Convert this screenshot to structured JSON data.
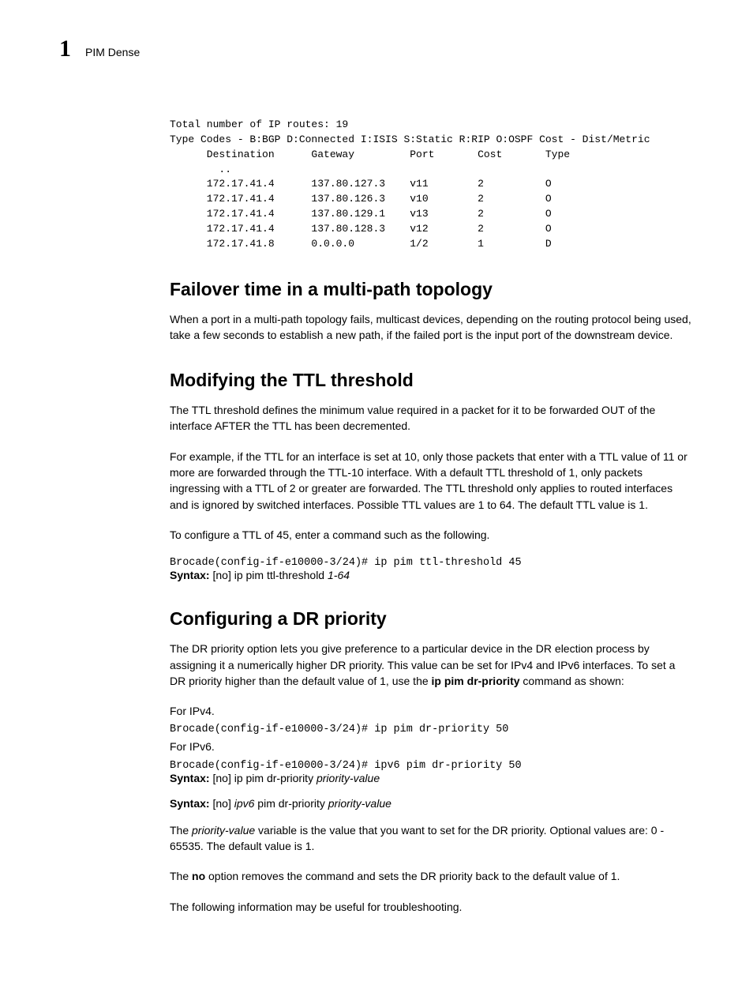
{
  "header": {
    "chapter": "1",
    "title": "PIM Dense"
  },
  "routes": {
    "line1": "Total number of IP routes: 19",
    "line2": "Type Codes - B:BGP D:Connected I:ISIS S:Static R:RIP O:OSPF Cost - Dist/Metric",
    "cols": "      Destination      Gateway         Port       Cost       Type",
    "dots": "        ..",
    "r1": "      172.17.41.4      137.80.127.3    v11        2          O",
    "r2": "      172.17.41.4      137.80.126.3    v10        2          O",
    "r3": "      172.17.41.4      137.80.129.1    v13        2          O",
    "r4": "      172.17.41.4      137.80.128.3    v12        2          O",
    "r5": "      172.17.41.8      0.0.0.0         1/2        1          D"
  },
  "sec1": {
    "title": "Failover time in a multi-path topology",
    "p1": "When a port in a multi-path topology fails, multicast devices, depending on the routing protocol being used, take a few seconds to establish a new path, if the failed port is the input port of the downstream device."
  },
  "sec2": {
    "title": "Modifying the TTL threshold",
    "p1": "The TTL threshold defines the minimum value required in a packet for it to be forwarded OUT of the interface AFTER the TTL has been decremented.",
    "p2": "For example, if the TTL for an interface is set at 10, only those packets that enter with a TTL value of 11 or more are forwarded through the TTL-10 interface. With a default TTL threshold of 1, only packets ingressing with a TTL of 2 or greater are forwarded. The TTL threshold only applies to routed interfaces and is ignored by switched interfaces. Possible TTL values are 1 to 64. The default TTL value is 1.",
    "p3": "To configure a TTL of 45, enter a command such as the following.",
    "cmd1": "Brocade(config-if-e10000-3/24)# ip pim ttl-threshold 45",
    "syntax_label": "Syntax:",
    "syntax_no": "no",
    "syntax_mid": "ip pim ttl-threshold",
    "syntax_arg": "1-64"
  },
  "sec3": {
    "title": "Configuring a DR priority",
    "p1a": "The DR priority option lets you give preference to a particular device in the DR election process by assigning it a numerically higher DR priority. This value can be set for IPv4 and IPv6 interfaces. To set a DR priority higher than the default value of 1, use the ",
    "p1cmd": "ip pim dr-priority",
    "p1b": " command as shown:",
    "p2": "For IPv4.",
    "cmd1": "Brocade(config-if-e10000-3/24)# ip pim dr-priority 50",
    "p3": "For IPv6.",
    "cmd2": "Brocade(config-if-e10000-3/24)# ipv6 pim dr-priority 50",
    "syntax_label": "Syntax:",
    "syn1_no": "no",
    "syn1_mid": "ip pim dr-priority",
    "syn1_arg": "priority-value",
    "syn2_no": "no",
    "syn2_ipv6": "ipv6",
    "syn2_mid": "pim dr-priority",
    "syn2_arg": "priority-value",
    "p4a": "The ",
    "p4var": "priority-value",
    "p4b": " variable is the value that you want to set for the DR priority. Optional values are: 0 - 65535. The default value is 1.",
    "p5a": "The ",
    "p5no": "no",
    "p5b": " option removes the command and sets the DR priority back to the default value of 1.",
    "p6": "The following information may be useful for troubleshooting."
  }
}
